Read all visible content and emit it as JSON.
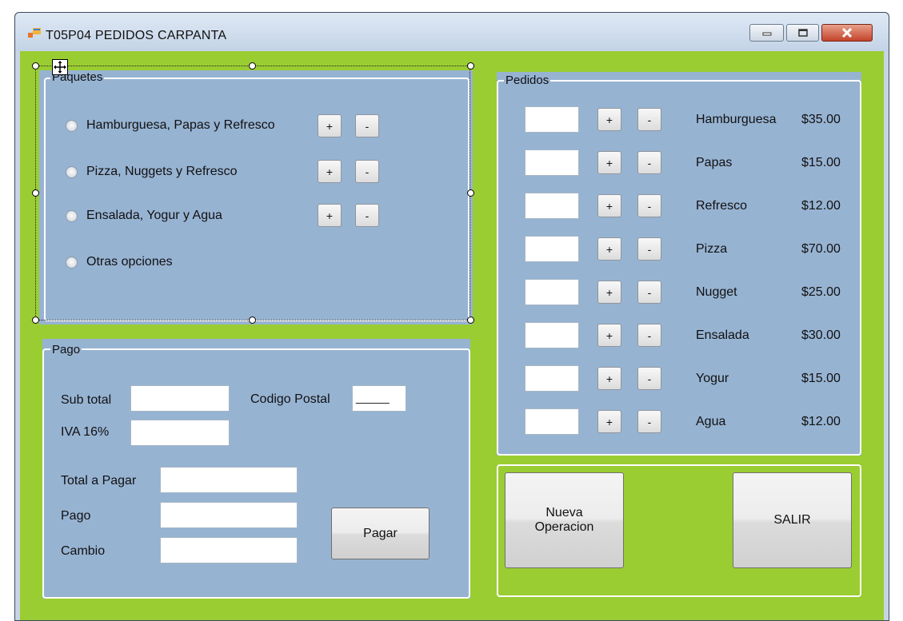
{
  "window": {
    "title": "T05P04 PEDIDOS CARPANTA",
    "icon": "form-icon",
    "colors": {
      "background": "#9acd32",
      "group": "#97b3d2"
    }
  },
  "paquetes": {
    "label": "Paquetes",
    "options": [
      {
        "label": "Hamburguesa, Papas y Refresco",
        "plus": "+",
        "minus": "-"
      },
      {
        "label": "Pizza, Nuggets y Refresco",
        "plus": "+",
        "minus": "-"
      },
      {
        "label": "Ensalada, Yogur y Agua",
        "plus": "+",
        "minus": "-"
      },
      {
        "label": "Otras opciones"
      }
    ]
  },
  "pedidos": {
    "label": "Pedidos",
    "items": [
      {
        "name": "Hamburguesa",
        "price": "$35.00",
        "qty": "",
        "plus": "+",
        "minus": "-"
      },
      {
        "name": "Papas",
        "price": "$15.00",
        "qty": "",
        "plus": "+",
        "minus": "-"
      },
      {
        "name": "Refresco",
        "price": "$12.00",
        "qty": "",
        "plus": "+",
        "minus": "-"
      },
      {
        "name": "Pizza",
        "price": "$70.00",
        "qty": "",
        "plus": "+",
        "minus": "-"
      },
      {
        "name": "Nugget",
        "price": "$25.00",
        "qty": "",
        "plus": "+",
        "minus": "-"
      },
      {
        "name": "Ensalada",
        "price": "$30.00",
        "qty": "",
        "plus": "+",
        "minus": "-"
      },
      {
        "name": "Yogur",
        "price": "$15.00",
        "qty": "",
        "plus": "+",
        "minus": "-"
      },
      {
        "name": "Agua",
        "price": "$12.00",
        "qty": "",
        "plus": "+",
        "minus": "-"
      }
    ]
  },
  "pago": {
    "label": "Pago",
    "subtotal_label": "Sub total",
    "subtotal_value": "",
    "codigo_postal_label": "Codigo Postal",
    "codigo_postal_value": "_____",
    "iva_label": "IVA 16%",
    "iva_value": "",
    "total_label": "Total a Pagar",
    "total_value": "",
    "pago_label": "Pago",
    "pago_value": "",
    "cambio_label": "Cambio",
    "cambio_value": "",
    "pagar_button": "Pagar"
  },
  "actions": {
    "nueva_line1": "Nueva",
    "nueva_line2": "Operacion",
    "salir": "SALIR"
  }
}
